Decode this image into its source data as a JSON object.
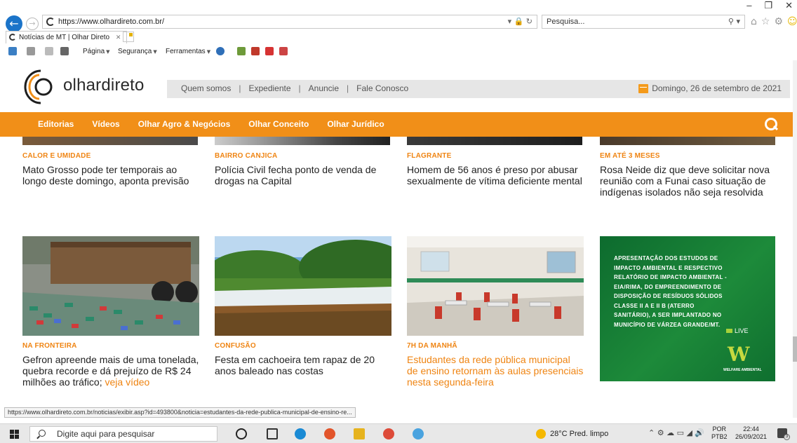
{
  "browser": {
    "url": "https://www.olhardireto.com.br/",
    "search_placeholder": "Pesquisa...",
    "tab_title": "Notícias de MT | Olhar Direto",
    "commands": [
      "Página",
      "Segurança",
      "Ferramentas"
    ],
    "status_url": "https://www.olhardireto.com.br/noticias/exibir.asp?id=493800&noticia=estudantes-da-rede-publica-municipal-de-ensino-re..."
  },
  "site": {
    "logo_text": "olhardireto",
    "top_links": [
      "Quem somos",
      "Expediente",
      "Anuncie",
      "Fale Conosco"
    ],
    "date": "Domingo, 26 de setembro de 2021",
    "menu": [
      "Editorias",
      "Vídeos",
      "Olhar Agro & Negócios",
      "Olhar Conceito",
      "Olhar Jurídico"
    ],
    "accent_color": "#f18f18"
  },
  "news_row1": [
    {
      "category": "CALOR E UMIDADE",
      "headline": "Mato Grosso pode ter temporais ao longo deste domingo, aponta previsão"
    },
    {
      "category": "BAIRRO CANJICA",
      "headline": "Polícia Civil fecha ponto de venda de drogas na Capital"
    },
    {
      "category": "FLAGRANTE",
      "headline": "Homem de 56 anos é preso por abusar sexualmente de vítima deficiente mental"
    },
    {
      "category": "EM ATÉ 3 MESES",
      "headline": "Rosa Neide diz que deve solicitar nova reunião com a Funai caso situação de indígenas isolados não seja resolvida"
    }
  ],
  "news_row2": [
    {
      "category": "NA FRONTEIRA",
      "headline": "Gefron apreende mais de uma tonelada, quebra recorde e dá prejuízo de R$ 24 milhões ao tráfico;",
      "extra": "veja vídeo"
    },
    {
      "category": "CONFUSÃO",
      "headline": "Festa em cachoeira tem rapaz de 20 anos baleado nas costas"
    },
    {
      "category": "7H DA MANHÃ",
      "headline": "Estudantes da rede pública municipal de ensino retornam às aulas presenciais nesta segunda-feira"
    }
  ],
  "ad": {
    "text": "APRESENTAÇÃO DOS ESTUDOS DE IMPACTO AMBIENTAL E RESPECTIVO RELATÓRIO DE IMPACTO AMBIENTAL - EIA/RIMA, DO EMPREENDIMENTO DE DISPOSIÇÃO DE RESÍDUOS SÓLIDOS CLASSE II A E II B (ATERRO SANITÁRIO), A SER IMPLANTADO NO MUNICÍPIO DE VÁRZEA GRANDE/MT.",
    "live_label": "LIVE",
    "brand": "WELFARE AMBIENTAL",
    "logo_letter": "W"
  },
  "taskbar": {
    "search_placeholder": "Digite aqui para pesquisar",
    "weather": "28°C  Pred. limpo",
    "lang_top": "POR",
    "lang_bottom": "PTB2",
    "time": "22:44",
    "date": "26/09/2021",
    "notifications": "3"
  }
}
